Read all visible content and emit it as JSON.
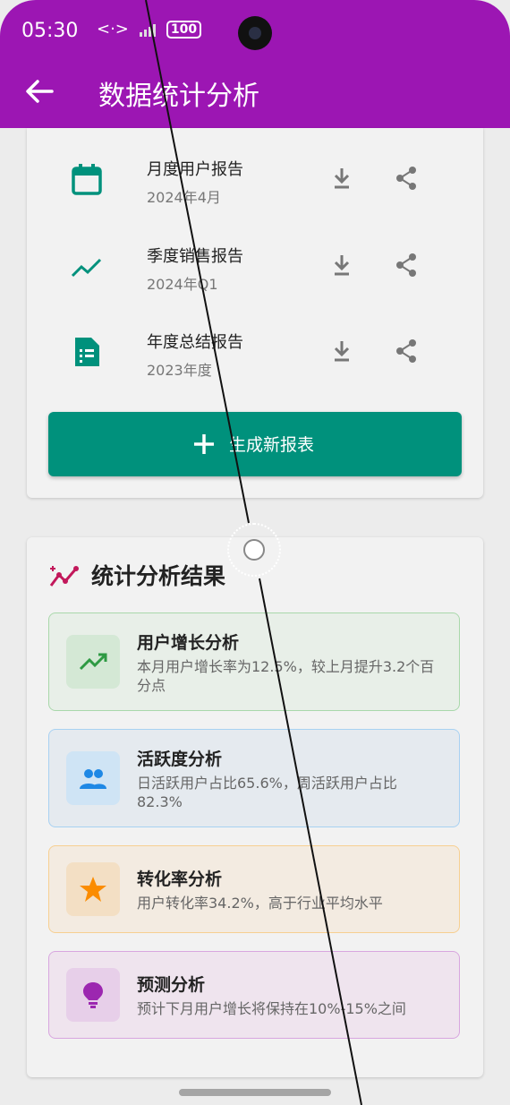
{
  "status": {
    "time": "05:30",
    "battery": "100"
  },
  "header": {
    "title": "数据统计分析"
  },
  "reports": [
    {
      "name": "月度用户报告",
      "date": "2024年4月",
      "icon": "calendar-icon"
    },
    {
      "name": "季度销售报告",
      "date": "2024年Q1",
      "icon": "trend-line-icon"
    },
    {
      "name": "年度总结报告",
      "date": "2023年度",
      "icon": "document-icon"
    }
  ],
  "generate_button": {
    "label": "生成新报表"
  },
  "analysis": {
    "title": "统计分析结果",
    "results": [
      {
        "title": "用户增长分析",
        "desc": "本月用户增长率为12.5%，较上月提升3.2个百分点",
        "icon": "trending-up-icon",
        "color": "#4caf50"
      },
      {
        "title": "活跃度分析",
        "desc": "日活跃用户占比65.6%，周活跃用户占比82.3%",
        "icon": "people-icon",
        "color": "#2196f3"
      },
      {
        "title": "转化率分析",
        "desc": "用户转化率34.2%，高于行业平均水平",
        "icon": "star-icon",
        "color": "#ff9800"
      },
      {
        "title": "预测分析",
        "desc": "预计下月用户增长将保持在10%-15%之间",
        "icon": "lightbulb-icon",
        "color": "#9c27b0"
      }
    ]
  },
  "colors": {
    "appbar": "#9c16b3",
    "teal": "#00917c"
  }
}
